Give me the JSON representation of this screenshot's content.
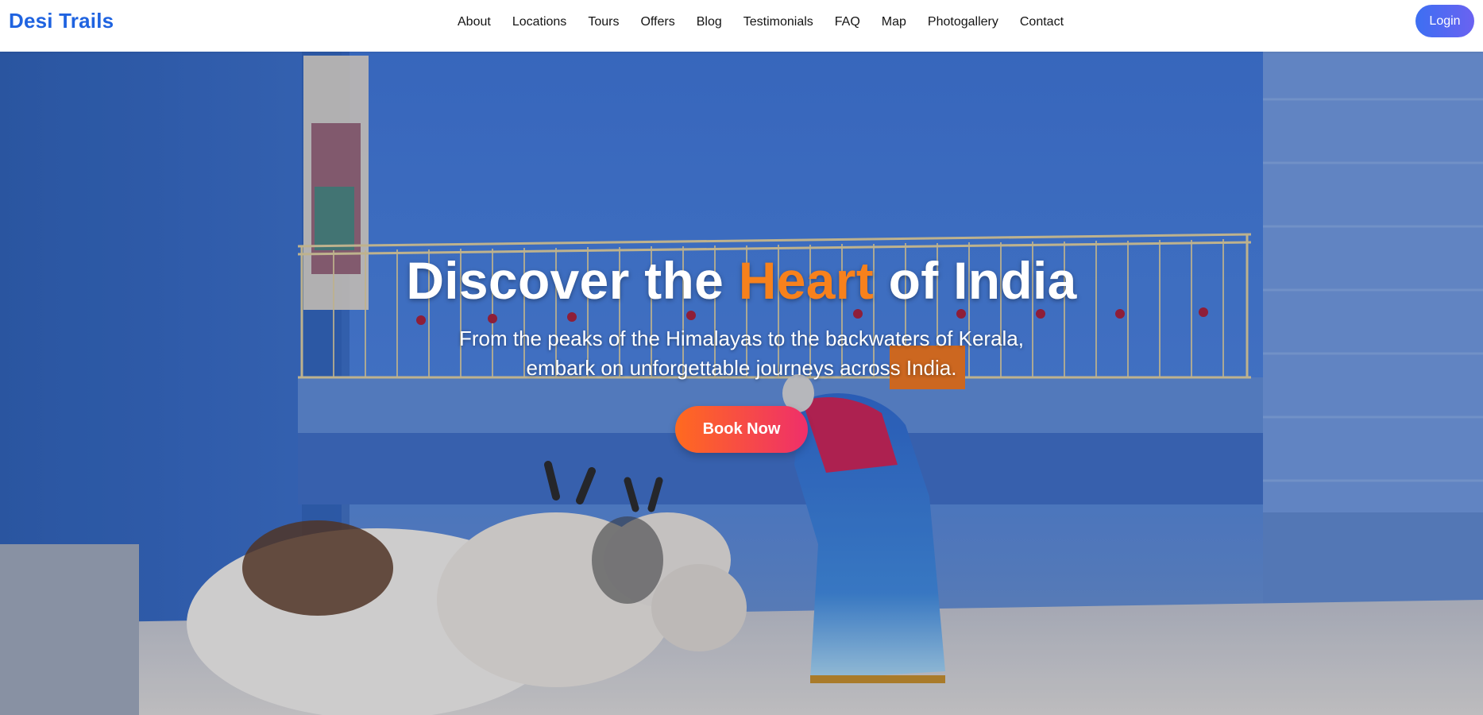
{
  "brand": {
    "name": "Desi Trails",
    "color": "#1f63e0"
  },
  "nav": {
    "items": [
      {
        "label": "About"
      },
      {
        "label": "Locations"
      },
      {
        "label": "Tours"
      },
      {
        "label": "Offers"
      },
      {
        "label": "Blog"
      },
      {
        "label": "Testimonials"
      },
      {
        "label": "FAQ"
      },
      {
        "label": "Map"
      },
      {
        "label": "Photogallery"
      },
      {
        "label": "Contact"
      }
    ],
    "login_label": "Login"
  },
  "hero": {
    "title_before": "Discover the ",
    "title_accent": "Heart",
    "title_after": " of India",
    "subtitle": "From the peaks of the Himalayas to the backwaters of Kerala, embark on unforgettable journeys across India.",
    "cta_label": "Book Now",
    "accent_color": "#f7811c",
    "background_image": "hero-photo"
  }
}
